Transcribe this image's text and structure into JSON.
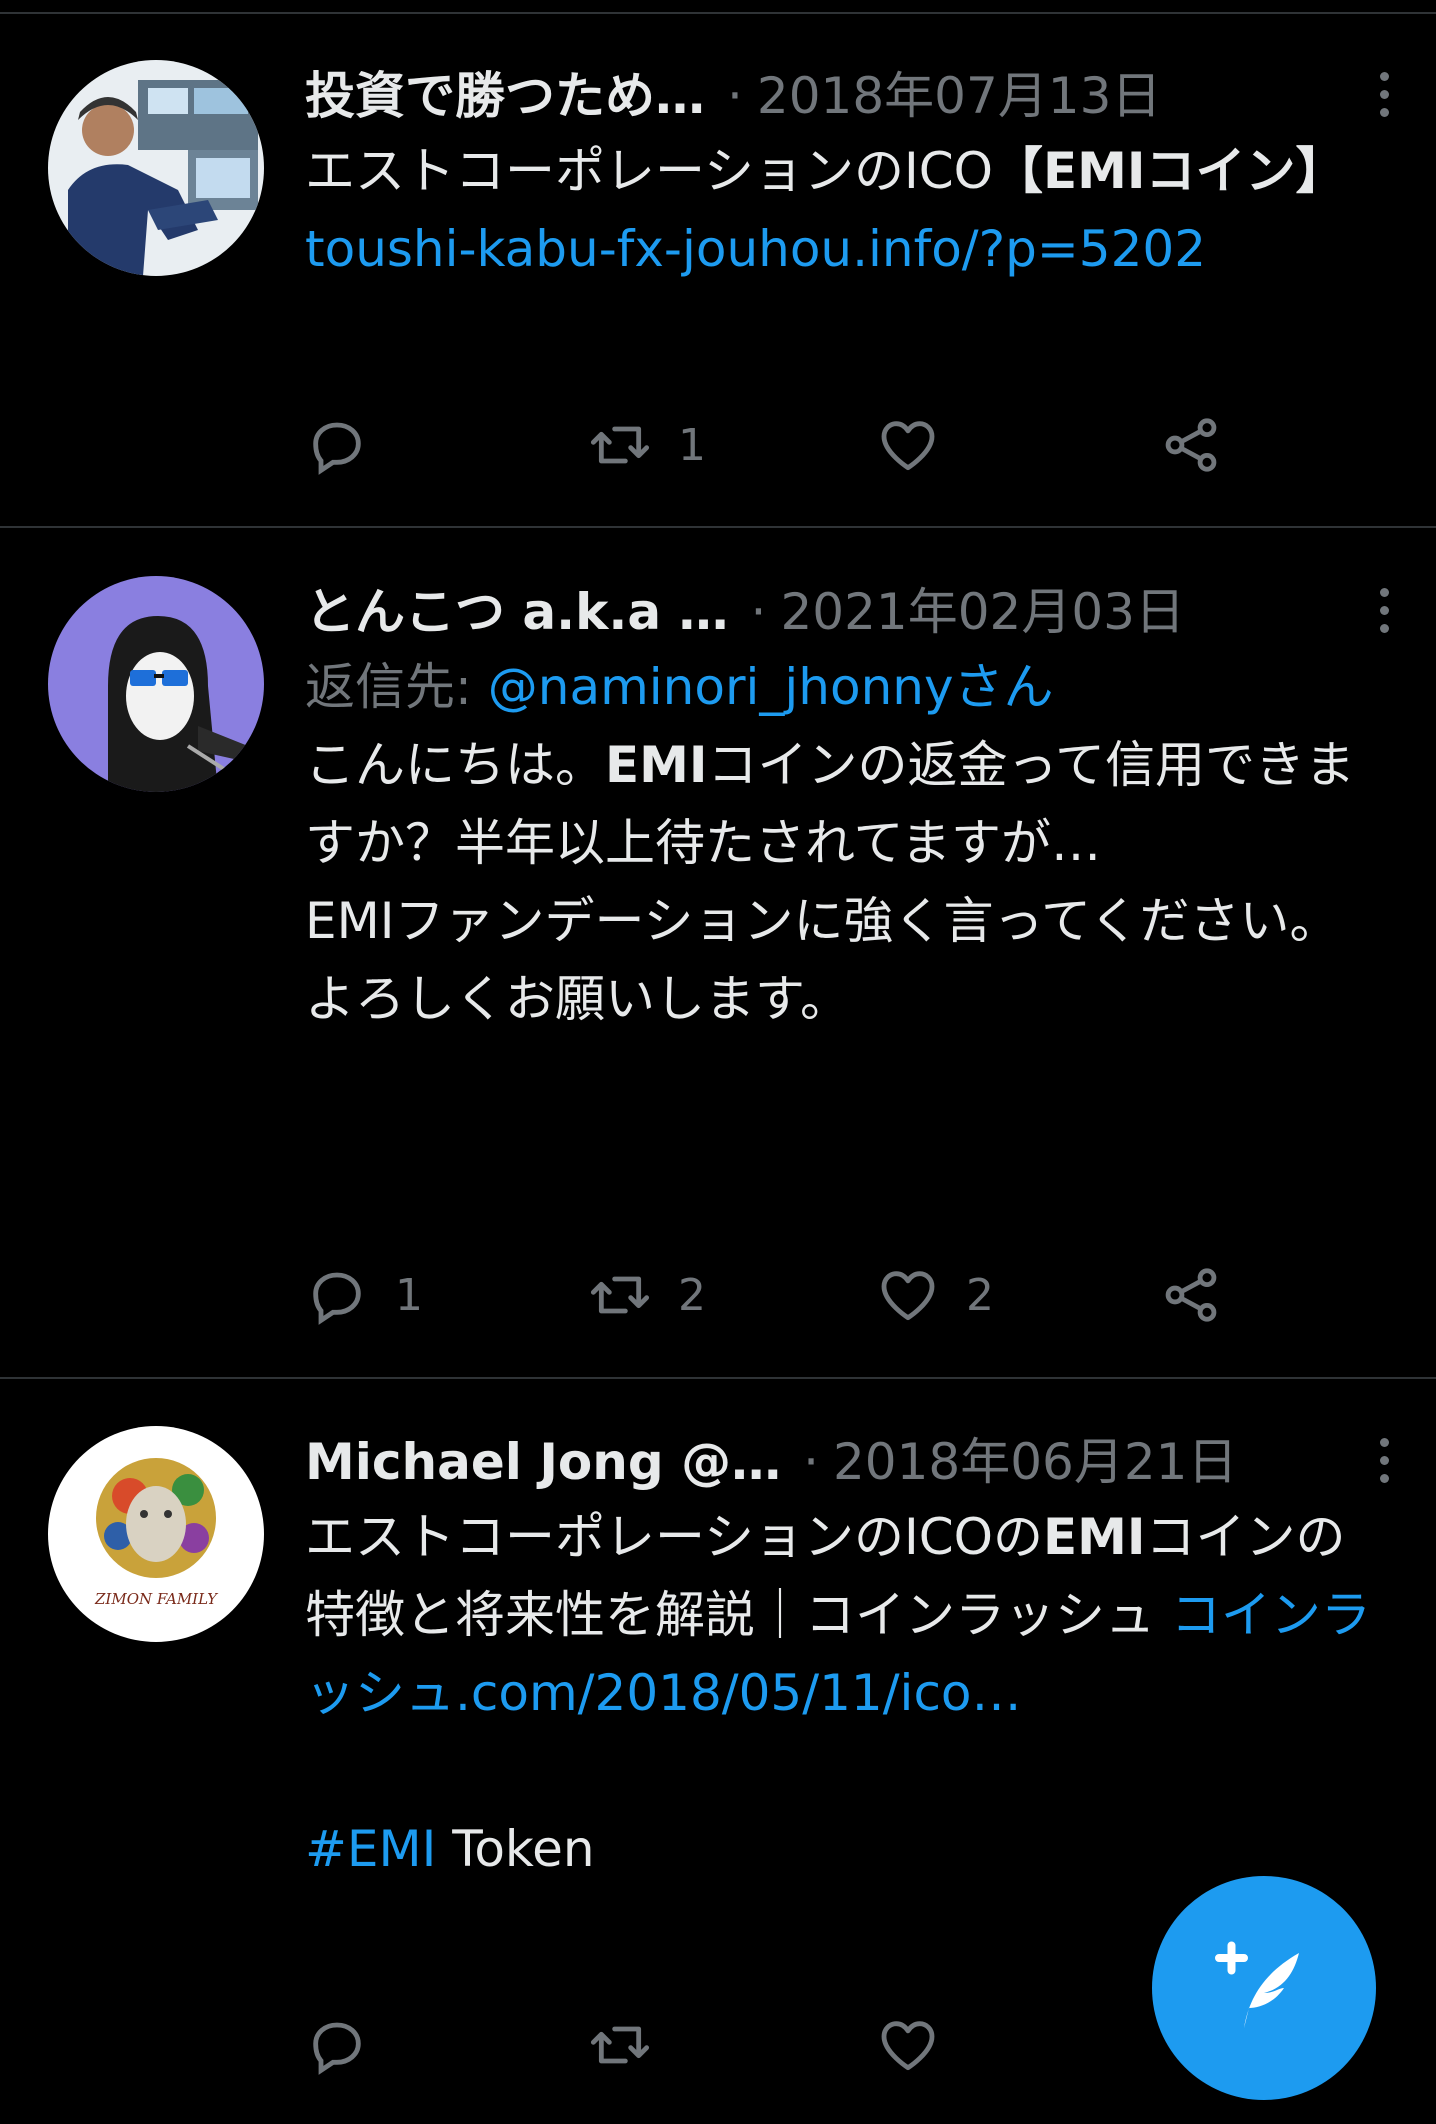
{
  "colors": {
    "background": "#000000",
    "text": "#e7e9ea",
    "muted": "#71767b",
    "link": "#1d9bf0",
    "divider": "#2f3336"
  },
  "tweets": [
    {
      "name": "投資で勝つため…",
      "separator": "·",
      "date": "2018年07月13日",
      "body_text": "エストコーポレーションのICO",
      "body_bold": "【EMIコイン】",
      "link": "toushi-kabu-fx-jouhou.info/?p=5202",
      "reply_count": "",
      "retweet_count": "1",
      "like_count": ""
    },
    {
      "name": "とんこつ a.k.a …",
      "separator": "·",
      "date": "2021年02月03日",
      "reply_prefix": "返信先: ",
      "reply_to": "@naminori_jhonnyさん",
      "body_text_1": "こんにちは。",
      "body_bold": "EMI",
      "body_text_2": "コインの返金って信用できますか？半年以上待たされてますが…",
      "body_line_2": "EMIファンデーションに強く言ってください。",
      "body_line_3": "よろしくお願いします。",
      "reply_count": "1",
      "retweet_count": "2",
      "like_count": "2"
    },
    {
      "name": "Michael Jong @…",
      "separator": "·",
      "date": "2018年06月21日",
      "body_text_1": "エストコーポレーションのICOの",
      "body_bold": "EMI",
      "body_text_2": "コインの特徴と将来性を解説｜コインラッシュ ",
      "link": "コインラッシュ.com/2018/05/11/ico…",
      "hashtag": "#EMI",
      "hashtag_suffix": " Token",
      "avatar_text": "ZIMON FAMILY",
      "reply_count": "",
      "retweet_count": "",
      "like_count": ""
    }
  ],
  "icons": [
    "reply-icon",
    "retweet-icon",
    "like-icon",
    "share-icon",
    "more-icon",
    "compose-icon"
  ]
}
